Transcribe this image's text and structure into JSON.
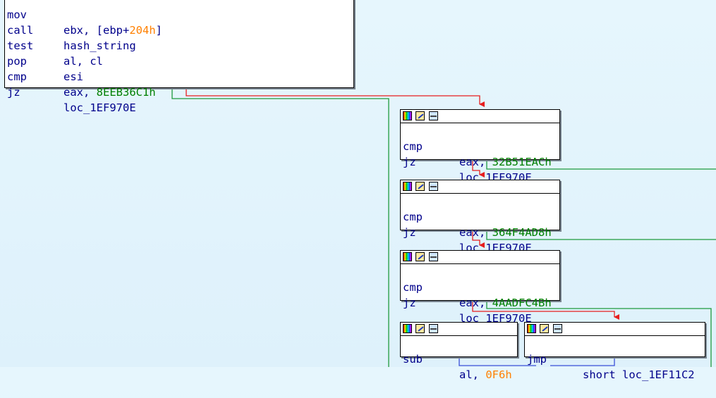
{
  "colors": {
    "background": "#e6f6fd",
    "edge_true": "#e61e1e",
    "edge_false": "#1e9a3c",
    "edge_uncond": "#3a4fd8",
    "mnemonic": "#00008b",
    "number": "#008000",
    "stack_var": "#ff8000"
  },
  "header_icons": [
    "color-palette-icon",
    "pencil-icon",
    "graph-icon"
  ],
  "block1": {
    "rows": [
      {
        "mnemonic": "mov",
        "operand_pre": "ebx, [ebp+",
        "operand_hl": "204h",
        "operand_post": "]"
      },
      {
        "mnemonic": "call",
        "operand": "hash_string"
      },
      {
        "mnemonic": "test",
        "operand": "al, cl"
      },
      {
        "mnemonic": "pop",
        "operand": "esi"
      },
      {
        "mnemonic": "cmp",
        "operand_pre": "eax, ",
        "operand_num": "8EEB36C1h"
      },
      {
        "mnemonic": "jz",
        "operand": "loc_1EF970E"
      }
    ]
  },
  "block2": {
    "cmp": "cmp",
    "cmp_pre": "eax, ",
    "cmp_num": "32B51EACh",
    "jz": "jz",
    "target": "loc_1EF970E"
  },
  "block3": {
    "cmp": "cmp",
    "cmp_pre": "eax, ",
    "cmp_num": "364F4AD8h",
    "jz": "jz",
    "target": "loc_1EF970E"
  },
  "block4": {
    "cmp": "cmp",
    "cmp_pre": "eax, ",
    "cmp_num": "4AADFC4Bh",
    "jz": "jz",
    "target": "loc_1EF970E"
  },
  "block5": {
    "mnemonic": "sub",
    "op_pre": "al, ",
    "op_num": "0F6h"
  },
  "block6": {
    "mnemonic": "jmp",
    "operand": "short loc_1EF11C2"
  }
}
